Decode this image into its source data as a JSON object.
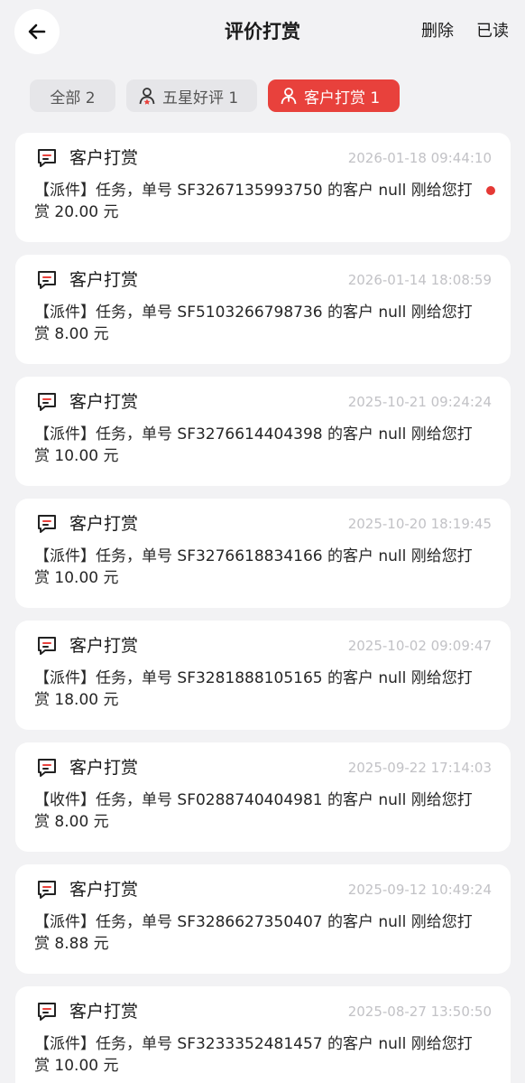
{
  "header": {
    "title": "评价打赏",
    "delete_label": "删除",
    "read_label": "已读"
  },
  "filters": [
    {
      "label": "全部 2",
      "selected": false,
      "icon": ""
    },
    {
      "label": "五星好评 1",
      "selected": false,
      "icon": "person-star-icon"
    },
    {
      "label": "客户打赏 1",
      "selected": true,
      "icon": "person-icon"
    }
  ],
  "colors": {
    "accent": "#e8413c",
    "unread_dot": "#e53935",
    "background": "#f2f2f4"
  },
  "messages": [
    {
      "title": "客户打赏",
      "time": "2026-01-18 09:44:10",
      "body": "【派件】任务，单号 SF3267135993750 的客户 null 刚给您打赏 20.00 元",
      "unread": true
    },
    {
      "title": "客户打赏",
      "time": "2026-01-14 18:08:59",
      "body": "【派件】任务，单号 SF5103266798736 的客户 null 刚给您打赏 8.00 元",
      "unread": false
    },
    {
      "title": "客户打赏",
      "time": "2025-10-21 09:24:24",
      "body": "【派件】任务，单号 SF3276614404398 的客户 null 刚给您打赏 10.00 元",
      "unread": false
    },
    {
      "title": "客户打赏",
      "time": "2025-10-20 18:19:45",
      "body": "【派件】任务，单号 SF3276618834166 的客户 null 刚给您打赏 10.00 元",
      "unread": false
    },
    {
      "title": "客户打赏",
      "time": "2025-10-02 09:09:47",
      "body": "【派件】任务，单号 SF3281888105165 的客户 null 刚给您打赏 18.00 元",
      "unread": false
    },
    {
      "title": "客户打赏",
      "time": "2025-09-22 17:14:03",
      "body": "【收件】任务，单号 SF0288740404981 的客户 null 刚给您打赏 8.00 元",
      "unread": false
    },
    {
      "title": "客户打赏",
      "time": "2025-09-12 10:49:24",
      "body": "【派件】任务，单号 SF3286627350407 的客户 null 刚给您打赏 8.88 元",
      "unread": false
    },
    {
      "title": "客户打赏",
      "time": "2025-08-27 13:50:50",
      "body": "【派件】任务，单号 SF3233352481457 的客户 null 刚给您打赏 10.00 元",
      "unread": false
    }
  ]
}
